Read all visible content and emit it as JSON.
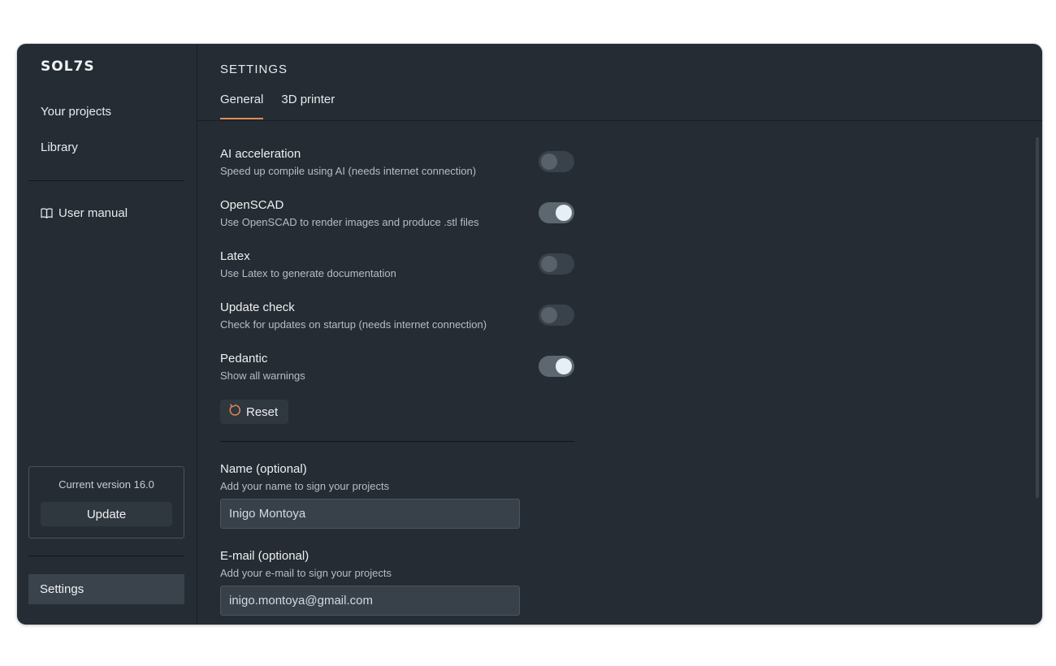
{
  "app": {
    "logo_text": "SOL7S"
  },
  "sidebar": {
    "nav": [
      {
        "label": "Your projects"
      },
      {
        "label": "Library"
      }
    ],
    "manual": {
      "label": "User manual",
      "icon": "book-icon"
    },
    "version": {
      "text": "Current version 16.0",
      "update_label": "Update"
    },
    "settings_label": "Settings"
  },
  "main": {
    "title": "SETTINGS",
    "tabs": [
      {
        "label": "General",
        "active": true
      },
      {
        "label": "3D printer",
        "active": false
      }
    ],
    "settings": [
      {
        "title": "AI acceleration",
        "desc": "Speed up compile using AI (needs internet connection)",
        "enabled": false
      },
      {
        "title": "OpenSCAD",
        "desc": "Use OpenSCAD to render images and produce .stl files",
        "enabled": true
      },
      {
        "title": "Latex",
        "desc": "Use Latex to generate documentation",
        "enabled": false
      },
      {
        "title": "Update check",
        "desc": "Check for updates on startup (needs internet connection)",
        "enabled": false
      },
      {
        "title": "Pedantic",
        "desc": "Show all warnings",
        "enabled": true
      }
    ],
    "reset": {
      "label": "Reset",
      "icon": "reset-icon"
    },
    "fields": [
      {
        "label": "Name (optional)",
        "desc": "Add your name to sign your projects",
        "value": "Inigo Montoya"
      },
      {
        "label": "E-mail (optional)",
        "desc": "Add your e-mail to sign your projects",
        "value": "inigo.montoya@gmail.com"
      }
    ]
  },
  "colors": {
    "accent": "#e08a56",
    "background": "#252c33"
  }
}
